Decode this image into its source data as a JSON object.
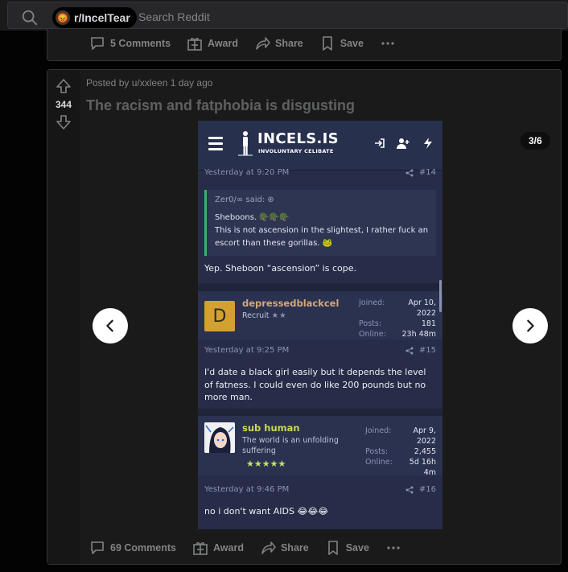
{
  "topbar": {
    "subreddit": "r/IncelTear",
    "search_placeholder": "Search Reddit"
  },
  "previous_post": {
    "comments": "5 Comments",
    "award": "Award",
    "share": "Share",
    "save": "Save"
  },
  "post": {
    "votes": "344",
    "posted_by": "Posted by u/xxleen 1 day ago",
    "title": "The racism and fatphobia is disgusting",
    "gallery_counter": "3/6",
    "comments": "69 Comments",
    "award": "Award",
    "share": "Share",
    "save": "Save"
  },
  "screenshot": {
    "site_title": "INCELS.IS",
    "site_subtitle": "INVOLUNTARY CELIBATE",
    "post14": {
      "time": "Yesterday at 9:20 PM",
      "num": "#14",
      "quote_author": "Zer0/∞ said:",
      "quote_line1": "Sheboons. 🪖🪖🪖",
      "quote_line2": "This is not ascension in the slightest, I rather fuck an escort than these gorillas. 🐸",
      "text": "Yep. Sheboon “ascension” is cope."
    },
    "user1": {
      "avatar_letter": "D",
      "name": "depressedblackcel",
      "title": "Recruit",
      "stars": "★★",
      "joined_label": "Joined:",
      "joined": "Apr 10, 2022",
      "posts_label": "Posts:",
      "posts": "181",
      "online_label": "Online:",
      "online": "23h 48m"
    },
    "post15": {
      "time": "Yesterday at 9:25 PM",
      "num": "#15",
      "text": "I'd date a black girl easily but it depends the level of fatness. I could even do like 200 pounds but no more man."
    },
    "user2": {
      "name": "sub human",
      "title": "The world is an unfolding suffering",
      "stars": "★★★★★",
      "joined_label": "Joined:",
      "joined": "Apr 9, 2022",
      "posts_label": "Posts:",
      "posts": "2,455",
      "online_label": "Online:",
      "online": "5d 16h 4m"
    },
    "post16": {
      "time": "Yesterday at 9:46 PM",
      "num": "#16",
      "text": "no i don't want AIDS 😂😂😂"
    }
  },
  "colors": {
    "accent_green": "#3fae6a",
    "username_green": "#c7d94f",
    "username_tan": "#d3a779",
    "star_green": "#c6e06a"
  }
}
